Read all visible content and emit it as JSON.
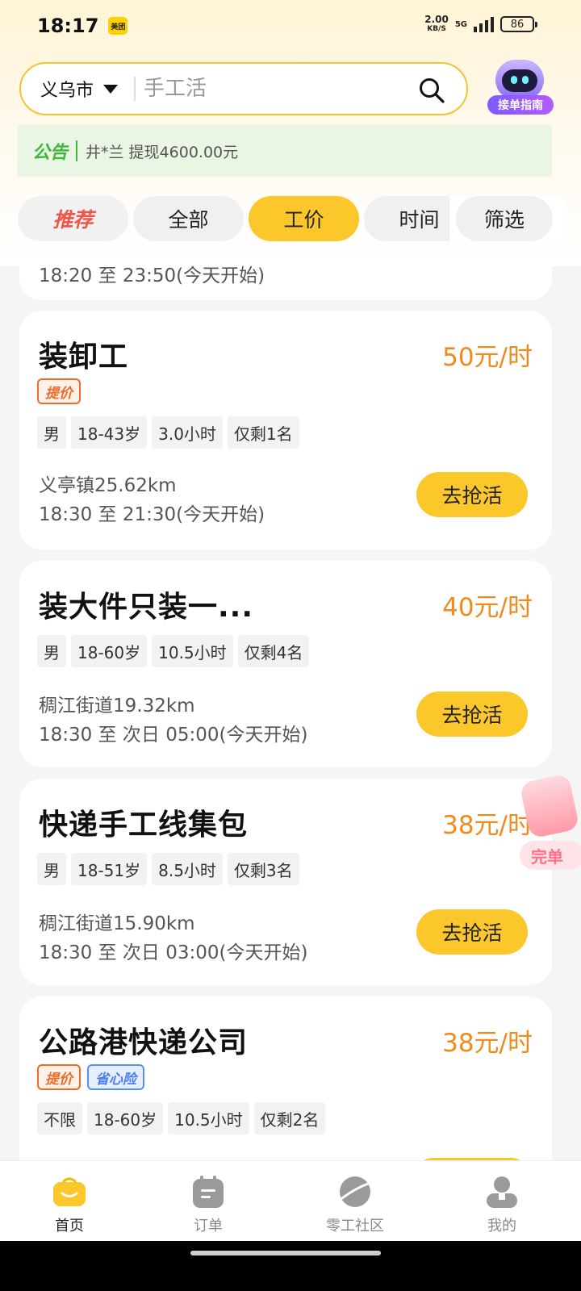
{
  "status_bar": {
    "time": "18:17",
    "app_badge": "美团",
    "net_speed": "2.00",
    "net_speed_unit": "KB/S",
    "network": "5G",
    "battery": "86"
  },
  "search": {
    "city": "义乌市",
    "placeholder": "手工活"
  },
  "assistant": {
    "label": "接单指南"
  },
  "notice": {
    "tag": "公告",
    "text": "井*兰 提现4600.00元"
  },
  "tabs": [
    {
      "label": "推荐"
    },
    {
      "label": "全部"
    },
    {
      "label": "工价",
      "active": true
    },
    {
      "label": "时间"
    },
    {
      "label": "筛选"
    }
  ],
  "jobs": [
    {
      "time": "18:20 至 23:50(今天开始)"
    },
    {
      "title": "装卸工",
      "price": "50元/时",
      "badges": [
        "提价"
      ],
      "chips": [
        "男",
        "18-43岁",
        "3.0小时",
        "仅剩1名"
      ],
      "location": "义亭镇25.62km",
      "time": "18:30 至 21:30(今天开始)",
      "button": "去抢活"
    },
    {
      "title": "装大件只装一...",
      "price": "40元/时",
      "chips": [
        "男",
        "18-60岁",
        "10.5小时",
        "仅剩4名"
      ],
      "location": "稠江街道19.32km",
      "time": "18:30 至 次日 05:00(今天开始)",
      "button": "去抢活"
    },
    {
      "title": "快递手工线集包",
      "price": "38元/时",
      "chips": [
        "男",
        "18-51岁",
        "8.5小时",
        "仅剩3名"
      ],
      "location": "稠江街道15.90km",
      "time": "18:30 至 次日 03:00(今天开始)",
      "button": "去抢活"
    },
    {
      "title": "公路港快递公司",
      "price": "38元/时",
      "badges": [
        "提价",
        "省心险"
      ],
      "chips": [
        "不限",
        "18-60岁",
        "10.5小时",
        "仅剩2名"
      ]
    }
  ],
  "promo": {
    "label": "完单"
  },
  "bottom_nav": [
    {
      "label": "首页",
      "icon": "home-bag-icon",
      "active": true
    },
    {
      "label": "订单",
      "icon": "order-icon"
    },
    {
      "label": "零工社区",
      "icon": "community-planet-icon"
    },
    {
      "label": "我的",
      "icon": "profile-icon"
    }
  ],
  "colors": {
    "accent": "#fbc72a",
    "price": "#f08a1a",
    "notice_green": "#3db83a",
    "raise_badge": "#f06a2a",
    "insurance_badge": "#4a7ef0"
  }
}
